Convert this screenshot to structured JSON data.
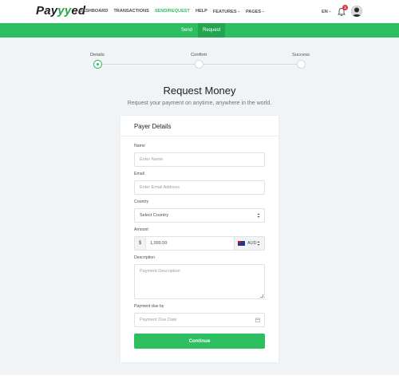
{
  "header": {
    "logo_prefix": "Pay",
    "logo_accent": "yy",
    "logo_suffix": "ed",
    "nav": [
      {
        "label": "DASHBOARD"
      },
      {
        "label": "TRANSACTIONS"
      },
      {
        "label": "SEND/REQUEST"
      },
      {
        "label": "HELP"
      },
      {
        "label": "FEATURES"
      },
      {
        "label": "PAGES"
      }
    ],
    "language": "EN",
    "notification_count": "2"
  },
  "subnav": {
    "tabs": [
      {
        "label": "Send"
      },
      {
        "label": "Request"
      }
    ]
  },
  "steps": [
    {
      "label": "Details"
    },
    {
      "label": "Confirm"
    },
    {
      "label": "Success"
    }
  ],
  "page": {
    "title": "Request Money",
    "subtitle": "Request your payment on anytime, anywhere in the world."
  },
  "form": {
    "card_title": "Payer Details",
    "name_label": "Name",
    "name_placeholder": "Enter Name",
    "email_label": "Email",
    "email_placeholder": "Enter Email Address",
    "country_label": "Country",
    "country_value": "Select Country",
    "amount_label": "Amount",
    "amount_prefix": "$",
    "amount_value": "1,000.00",
    "currency_value": "AUD",
    "description_label": "Description",
    "description_placeholder": "Payment Description",
    "due_label": "Payment due by",
    "due_placeholder": "Payment Due Date",
    "continue_label": "Continue"
  },
  "colors": {
    "brand_green": "#2dbe60",
    "badge_red": "#dc3545"
  }
}
